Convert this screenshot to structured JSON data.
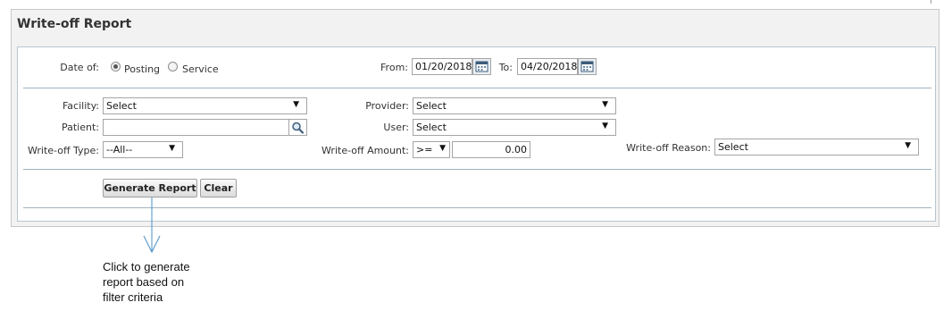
{
  "report": {
    "title": "Write-off Report"
  },
  "date_of": {
    "label": "Date of:",
    "options": [
      {
        "label": "Posting",
        "selected": true
      },
      {
        "label": "Service",
        "selected": false
      }
    ]
  },
  "from": {
    "label": "From:",
    "value": "01/20/2018"
  },
  "to": {
    "label": "To:",
    "value": "04/20/2018"
  },
  "facility": {
    "label": "Facility:",
    "value": "Select"
  },
  "provider": {
    "label": "Provider:",
    "value": "Select"
  },
  "patient": {
    "label": "Patient:",
    "value": ""
  },
  "user": {
    "label": "User:",
    "value": "Select"
  },
  "writeoff_type": {
    "label": "Write-off Type:",
    "value": "--All--"
  },
  "writeoff_amount": {
    "label": "Write-off Amount:",
    "operator": ">=",
    "value": "0.00"
  },
  "writeoff_reason": {
    "label": "Write-off Reason:",
    "value": "Select"
  },
  "buttons": {
    "generate": "Generate Report",
    "clear": "Clear"
  },
  "annotation": {
    "lines": [
      "Click to generate",
      "report based on",
      "filter criteria"
    ]
  },
  "colors": {
    "annotation_arrow": "#4a90c8",
    "panel_bg": "#f2f2f2",
    "divider": "#9fb3bf"
  },
  "icons": {
    "calendar": "calendar-icon",
    "search": "magnifier-icon",
    "dropdown": "triangle-down"
  }
}
